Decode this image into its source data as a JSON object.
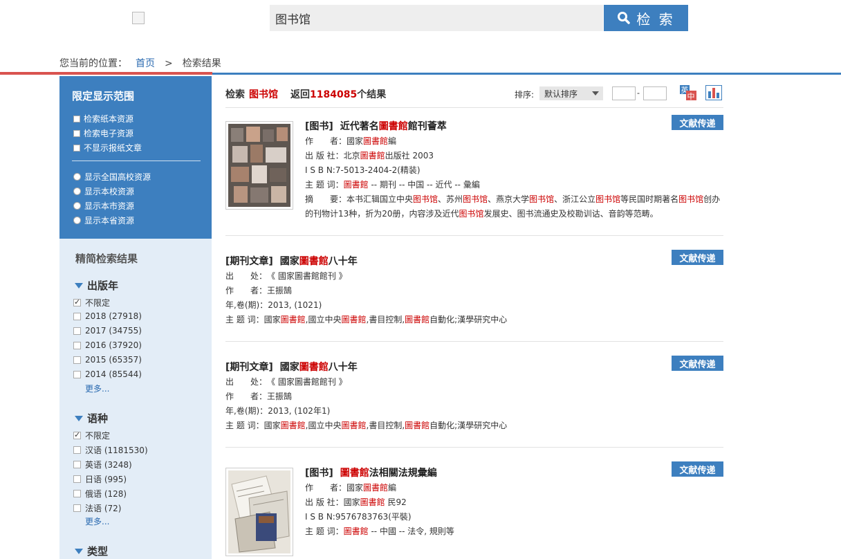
{
  "header": {
    "search_value": "图书馆",
    "search_button": "检 索"
  },
  "breadcrumb": {
    "prefix": "您当前的位置：",
    "home": "首页",
    "separator": ">",
    "current": "检索结果"
  },
  "scope": {
    "title": "限定显示范围",
    "checkboxes": [
      "检索纸本资源",
      "检索电子资源",
      "不显示报纸文章"
    ],
    "radios": [
      "显示全国高校资源",
      "显示本校资源",
      "显示本市资源",
      "显示本省资源"
    ]
  },
  "refine": {
    "title": "精简检索结果",
    "year": {
      "head": "出版年",
      "items": [
        {
          "label": "不限定",
          "checked": true
        },
        {
          "label": "2018 (27918)",
          "checked": false
        },
        {
          "label": "2017 (34755)",
          "checked": false
        },
        {
          "label": "2016 (37920)",
          "checked": false
        },
        {
          "label": "2015 (65357)",
          "checked": false
        },
        {
          "label": "2014 (85544)",
          "checked": false
        }
      ],
      "more": "更多..."
    },
    "language": {
      "head": "语种",
      "items": [
        {
          "label": "不限定",
          "checked": true
        },
        {
          "label": "汉语 (1181530)",
          "checked": false
        },
        {
          "label": "英语 (3248)",
          "checked": false
        },
        {
          "label": "日语 (995)",
          "checked": false
        },
        {
          "label": "俄语 (128)",
          "checked": false
        },
        {
          "label": "法语 (72)",
          "checked": false
        }
      ],
      "more": "更多..."
    },
    "type": {
      "head": "类型"
    }
  },
  "results_header": {
    "search_label": "检索",
    "keyword": "图书馆",
    "return_label": "返回",
    "count": "1184085",
    "count_suffix": "个结果",
    "sort_label": "排序:",
    "sort_value": "默认排序",
    "year_dash": "-"
  },
  "deliver_label": "文献传递",
  "results": [
    {
      "category": "[图书]",
      "title_pre": "近代著名",
      "title_hl": "圖書館",
      "title_post": "館刊薈萃",
      "author_label": "作　　者：",
      "author_pre": "國家",
      "author_hl": "圖書館",
      "author_post": "編",
      "publisher_label": "出 版 社：",
      "publisher_pre": "北京",
      "publisher_hl": "圖書館",
      "publisher_post": "出版社 2003",
      "isbn_label": "I S B N: ",
      "isbn": "7-5013-2404-2(精装)",
      "subject_label": "主 题 词：",
      "subject_hl": "圖書館",
      "subject_post": " -- 期刊 -- 中国 -- 近代 -- 彙編",
      "abstract_label": "摘　　要：",
      "abs_1": "本书汇辑国立中央",
      "abs_hl1": "图书馆",
      "abs_2": "、苏州",
      "abs_hl2": "图书馆",
      "abs_3": "、燕京大学",
      "abs_hl3": "图书馆",
      "abs_4": "、浙江公立",
      "abs_hl4": "图书馆",
      "abs_5": "等民国时期著名",
      "abs_hl5": "图书馆",
      "abs_6": "创办",
      "abs_line2_pre": "的刊物计13种，折为20册，内容涉及近代",
      "abs_line2_hl": "图书馆",
      "abs_line2_post": "发展史、图书流通史及校勘训诂、音韵等范畴。"
    },
    {
      "category": "[期刊文章]",
      "title_pre": "國家",
      "title_hl": "圖書館",
      "title_post": "八十年",
      "source_label": "出　　处：",
      "source": "《 國家圖書館館刊 》",
      "author_label": "作　　者：",
      "author": "王振鵠",
      "volume_label": "年,卷(期)：",
      "volume": "2013, (1021)",
      "subject_label": "主 题 词：",
      "sub_1": "國家",
      "sub_hl1": "圖書館",
      "sub_2": ",國立中央",
      "sub_hl2": "圖書館",
      "sub_3": ",書目控制,",
      "sub_hl3": "圖書館",
      "sub_4": "自動化;漢學研究中心"
    },
    {
      "category": "[期刊文章]",
      "title_pre": "國家",
      "title_hl": "圖書館",
      "title_post": "八十年",
      "source_label": "出　　处：",
      "source": "《 國家圖書館館刊 》",
      "author_label": "作　　者：",
      "author": "王振鵠",
      "volume_label": "年,卷(期)：",
      "volume": "2013, (102年1)",
      "subject_label": "主 题 词：",
      "sub_1": "國家",
      "sub_hl1": "圖書館",
      "sub_2": ",國立中央",
      "sub_hl2": "圖書館",
      "sub_3": ",書目控制,",
      "sub_hl3": "圖書館",
      "sub_4": "自動化;漢學研究中心"
    },
    {
      "category": "[图书]",
      "title_hl": "圖書館",
      "title_post": "法相關法規彙編",
      "author_label": "作　　者：",
      "author_pre": "國家",
      "author_hl": "圖書館",
      "author_post": "編",
      "publisher_label": "出 版 社：",
      "publisher_pre": "國家",
      "publisher_hl": "圖書館",
      "publisher_post": " 民92",
      "isbn_label": "I S B N: ",
      "isbn": "9576783763(平裝)",
      "subject_label": "主 题 词：",
      "subject_hl": "圖書館",
      "subject_post": " -- 中國 -- 法令, 規則等"
    }
  ]
}
